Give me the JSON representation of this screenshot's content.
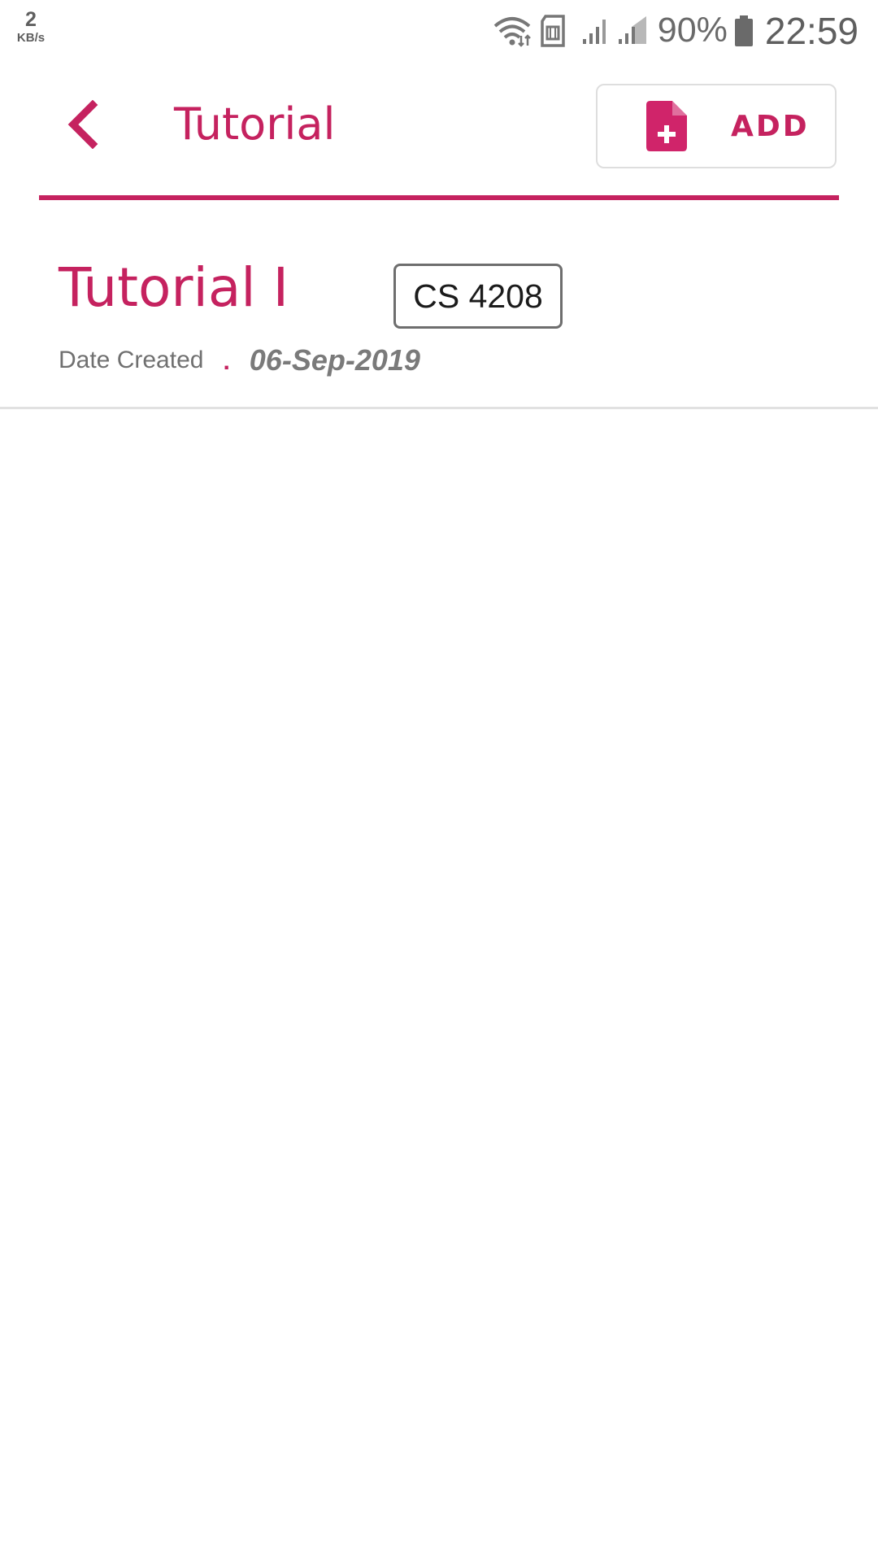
{
  "status_bar": {
    "net_speed_value": "2",
    "net_speed_unit": "KB/s",
    "battery_percent": "90%",
    "time": "22:59",
    "icons": [
      "wifi-icon",
      "sim-icon",
      "signal-icon",
      "signal-icon",
      "battery-icon"
    ]
  },
  "app_bar": {
    "title": "Tutorial",
    "add_button_label": "ADD",
    "back_icon": "chevron-left-icon",
    "add_icon": "note-add-icon"
  },
  "items": [
    {
      "title": "Tutorial I",
      "course_code": "CS 4208",
      "date_label": "Date Created",
      "separator": ".",
      "date_value": "06-Sep-2019"
    }
  ],
  "colors": {
    "accent": "#c5225f",
    "muted_text": "#707070",
    "badge_border": "#6e6e6e",
    "divider": "#e1e1e1"
  }
}
